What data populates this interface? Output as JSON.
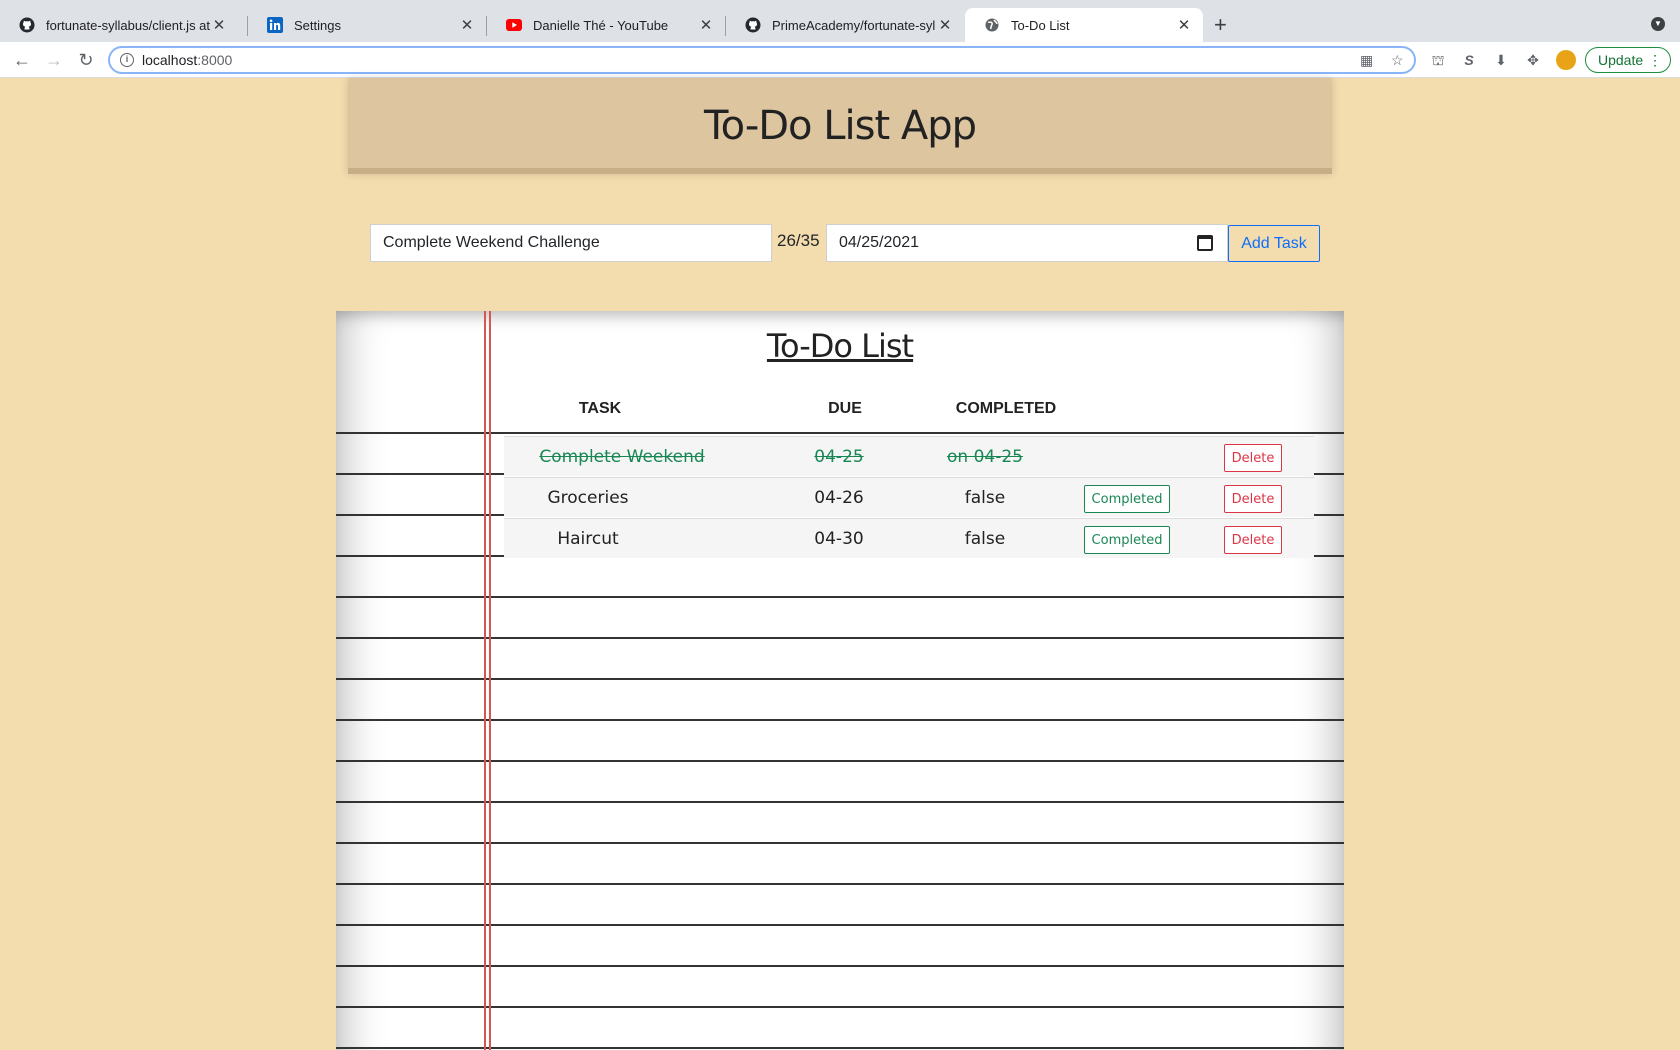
{
  "browser": {
    "tabs": [
      {
        "title": "fortunate-syllabus/client.js at m",
        "favicon": "github-icon"
      },
      {
        "title": "Settings",
        "favicon": "linkedin-icon"
      },
      {
        "title": "Danielle Thé - YouTube",
        "favicon": "youtube-icon"
      },
      {
        "title": "PrimeAcademy/fortunate-syllab",
        "favicon": "github-icon"
      },
      {
        "title": "To-Do List",
        "favicon": "globe-icon",
        "active": true
      }
    ],
    "url_host": "localhost",
    "url_port": ":8000",
    "update_label": "Update"
  },
  "page": {
    "app_title": "To-Do List App",
    "task_input_value": "Complete Weekend Challenge",
    "char_counter": "26/35",
    "date_input_value": "04/25/2021",
    "add_button_label": "Add Task",
    "list_title": "To-Do List",
    "columns": {
      "task": "TASK",
      "due": "DUE",
      "completed": "COMPLETED"
    },
    "tasks": [
      {
        "task": "Complete Weekend Challenge",
        "due": "04-25",
        "completed": "on 04-25",
        "done": true,
        "delete_label": "Delete"
      },
      {
        "task": "Groceries",
        "due": "04-26",
        "completed": "false",
        "done": false,
        "complete_label": "Completed",
        "delete_label": "Delete"
      },
      {
        "task": "Haircut",
        "due": "04-30",
        "completed": "false",
        "done": false,
        "complete_label": "Completed",
        "delete_label": "Delete"
      }
    ]
  },
  "colors": {
    "page_bg": "#f3dcae",
    "banner_bg": "#dcc59f",
    "success": "#198754",
    "danger": "#dc3545",
    "primary": "#0d6efd",
    "margin_line": "#d65555"
  }
}
